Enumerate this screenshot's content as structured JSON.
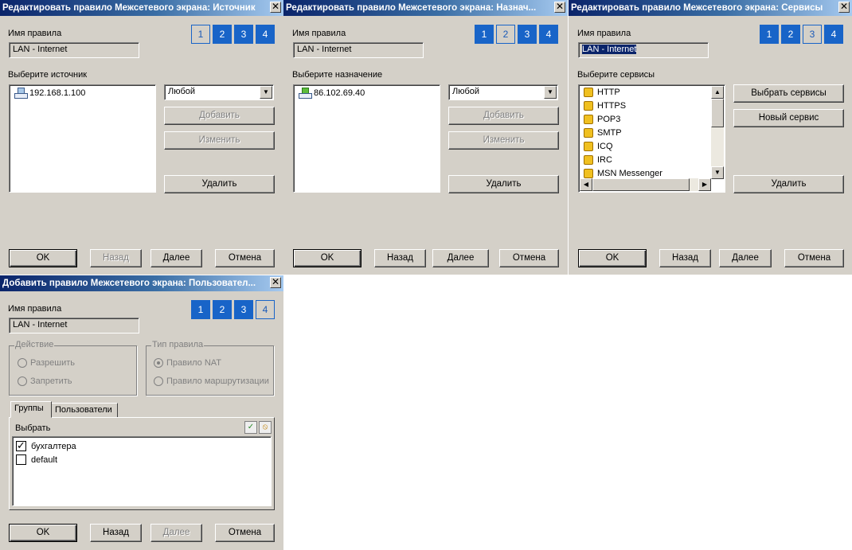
{
  "common": {
    "rule_name_label": "Имя правила",
    "rule_name_value": "LAN - Internet",
    "steps": [
      "1",
      "2",
      "3",
      "4"
    ],
    "close_glyph": "✕",
    "buttons": {
      "ok": "OK",
      "back": "Назад",
      "next": "Далее",
      "cancel": "Отмена"
    }
  },
  "win_source": {
    "title": "Редактировать правило Межсетевого экрана: Источник",
    "list_label": "Выберите источник",
    "items": [
      "192.168.1.100"
    ],
    "combo_value": "Любой",
    "add": "Добавить",
    "edit": "Изменить",
    "delete": "Удалить"
  },
  "win_dest": {
    "title": "Редактировать правило Межсетевого экрана: Назнач...",
    "list_label": "Выберите назначение",
    "items": [
      "86.102.69.40"
    ],
    "combo_value": "Любой",
    "add": "Добавить",
    "edit": "Изменить",
    "delete": "Удалить"
  },
  "win_services": {
    "title": "Редактировать правило Межсетевого экрана: Сервисы",
    "list_label": "Выберите сервисы",
    "items": [
      "HTTP",
      "HTTPS",
      "POP3",
      "SMTP",
      "ICQ",
      "IRC",
      "MSN Messenger"
    ],
    "choose": "Выбрать сервисы",
    "new": "Новый сервис",
    "delete": "Удалить"
  },
  "win_users": {
    "title": "Добавить правило Межсетевого экрана: Пользовател...",
    "action_group": "Действие",
    "allow": "Разрешить",
    "deny": "Запретить",
    "type_group": "Тип правила",
    "nat": "Правило NAT",
    "routing": "Правило маршрутизации",
    "tab_groups": "Группы",
    "tab_users": "Пользователи",
    "select_label": "Выбрать",
    "items": [
      {
        "label": "бухгалтера",
        "checked": true
      },
      {
        "label": "default",
        "checked": false
      }
    ]
  }
}
